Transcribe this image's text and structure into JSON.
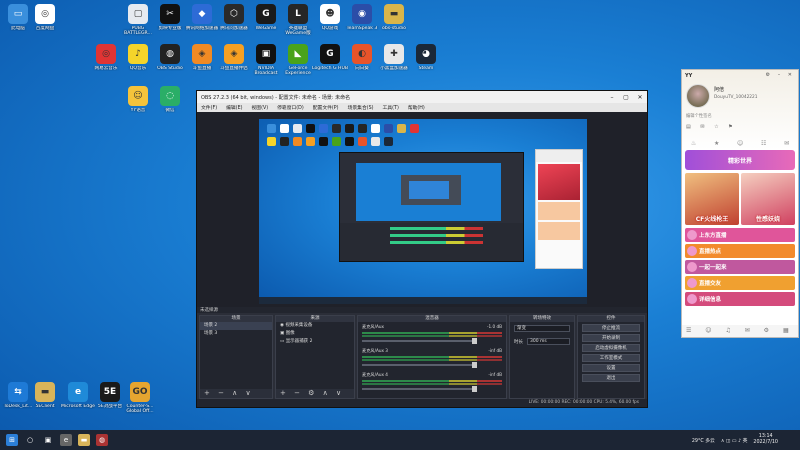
{
  "desktop_icons": [
    {
      "label": "此电脑",
      "color": "#3a8fdc",
      "glyph": "▭"
    },
    {
      "label": "百度网盘",
      "color": "#ffffff",
      "glyph": "◎"
    },
    {
      "label": "PUBG BATTLEGR...",
      "color": "#e6eaf0",
      "glyph": "▢"
    },
    {
      "label": "剪映专业版",
      "color": "#111111",
      "glyph": "✂"
    },
    {
      "label": "腾讯网络加速器",
      "color": "#2d6bd6",
      "glyph": "◆"
    },
    {
      "label": "腾讯问加速器",
      "color": "#2a2a2a",
      "glyph": "⬡"
    },
    {
      "label": "WeGame",
      "color": "#1a1a1a",
      "glyph": "G"
    },
    {
      "label": "英雄联盟 WeGame版",
      "color": "#262626",
      "glyph": "L"
    },
    {
      "label": "QQ游戏",
      "color": "#ffffff",
      "glyph": "☻"
    },
    {
      "label": "TeamSpeak 3",
      "color": "#2b4ea8",
      "glyph": "◉"
    },
    {
      "label": "obs-studio",
      "color": "#d9b54a",
      "glyph": "▬"
    },
    {
      "label": "网易云音乐",
      "color": "#e03434",
      "glyph": "◎"
    },
    {
      "label": "QQ音乐",
      "color": "#f5d42a",
      "glyph": "♪"
    },
    {
      "label": "OBS Studio",
      "color": "#222222",
      "glyph": "◍"
    },
    {
      "label": "斗鱼直播",
      "color": "#f08a24",
      "glyph": "◈"
    },
    {
      "label": "斗鱼直播伴侣",
      "color": "#f6a022",
      "glyph": "◈"
    },
    {
      "label": "NVIDIA Broadcast",
      "color": "#111111",
      "glyph": "▣"
    },
    {
      "label": "GeForce Experience",
      "color": "#4aa31a",
      "glyph": "◣"
    },
    {
      "label": "Logitech G HUB",
      "color": "#111111",
      "glyph": "G"
    },
    {
      "label": "向日葵",
      "color": "#e8542a",
      "glyph": "◐"
    },
    {
      "label": "小黑盒加速器",
      "color": "#e8e8e8",
      "glyph": "✚"
    },
    {
      "label": "Steam",
      "color": "#1b2838",
      "glyph": "◕"
    },
    {
      "label": "YY语音",
      "color": "#f5c33b",
      "glyph": "☺"
    },
    {
      "label": "微信",
      "color": "#2aae67",
      "glyph": "◌"
    },
    {
      "label": "ToDesk_Lit...",
      "color": "#1e7ad6",
      "glyph": "⇆"
    },
    {
      "label": "5EClient",
      "color": "#d8b45a",
      "glyph": "▬"
    },
    {
      "label": "Microsoft Edge",
      "color": "#1f8ad8",
      "glyph": "e"
    },
    {
      "label": "5E对战平台",
      "color": "#1a1a1a",
      "glyph": "5E"
    },
    {
      "label": "Counter-S... Global Off...",
      "color": "#e5a530",
      "glyph": "GO"
    }
  ],
  "obs": {
    "title": "OBS 27.2.3 (64 bit, windows) - 配置文件: 未命名 - 场景: 未命名",
    "menu": [
      "文件(F)",
      "编辑(E)",
      "视图(V)",
      "停靠窗口(D)",
      "配置文件(P)",
      "场景集合(S)",
      "工具(T)",
      "帮助(H)"
    ],
    "no_source_selected": "未选择源",
    "docks": {
      "scenes_title": "场景",
      "scenes": [
        "场景 2",
        "场景 3"
      ],
      "sources_title": "来源",
      "sources": [
        "视频采集设备",
        "图像",
        "显示器捕获 2"
      ],
      "mixer_title": "混音器",
      "mixer_tracks": [
        {
          "name": "麦克风/Aux",
          "db": "-1.0 dB"
        },
        {
          "name": "麦克风/Aux 3",
          "db": "-inf dB"
        },
        {
          "name": "麦克风/Aux 4",
          "db": "-inf dB"
        }
      ],
      "transitions_title": "转场特效",
      "transition_type": "渐变",
      "duration_label": "时长",
      "duration_value": "300 ms",
      "controls_title": "控件",
      "controls": [
        "停止推流",
        "开始录制",
        "启动虚拟摄像机",
        "工作室模式",
        "设置",
        "退出"
      ]
    },
    "status": "LIVE: 00:00:00   REC: 00:00:00   CPU: 5.4%, 60.00 fps"
  },
  "yy": {
    "app_label": "YY",
    "user_name": "阿倍",
    "user_id": "DouyuTV_10042221",
    "signature": "编辑个性签名",
    "banner": "精彩世界",
    "thumb_left": "CF火线枪王",
    "thumb_right": "性感妖娆",
    "feed": [
      "上东方直播",
      "直播热点",
      "一起一起来",
      "直播交友",
      "详细信息"
    ]
  },
  "taskbar": {
    "weather": "29°C 多云",
    "time": "13:14",
    "date": "2022/7/10"
  }
}
